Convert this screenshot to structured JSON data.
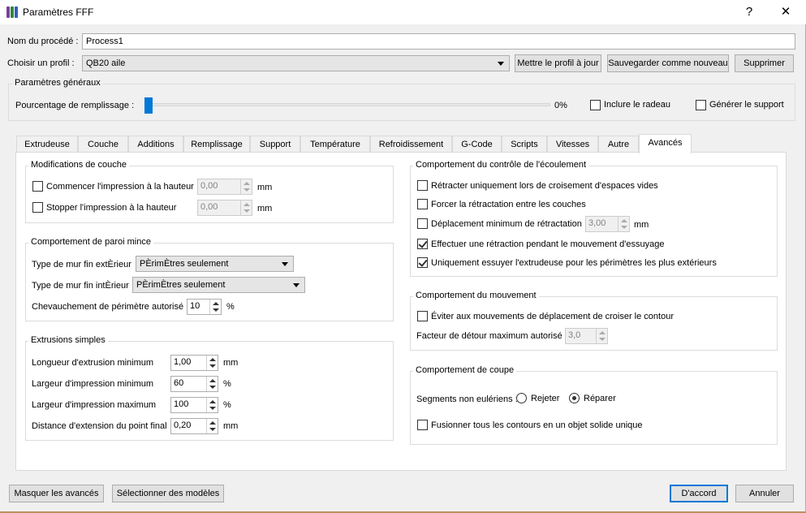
{
  "window": {
    "title": "Paramètres FFF",
    "help_glyph": "?",
    "close_glyph": "✕",
    "icon_colors": [
      "#7b3fa0",
      "#2e8b3a",
      "#2f5fb8"
    ]
  },
  "header": {
    "process_name_label": "Nom du procédé :",
    "process_name_value": "Process1",
    "profile_label": "Choisir un profil :",
    "profile_value": "QB20 aile",
    "update_profile_label": "Mettre le profil à jour",
    "save_as_new_label": "Sauvegarder comme nouveau",
    "delete_label": "Supprimer"
  },
  "general": {
    "title": "Paramètres généraux",
    "fill_percent_label": "Pourcentage de remplissage :",
    "fill_percent_value": "0%",
    "fill_percent_level": 0,
    "include_raft_label": "Inclure le radeau",
    "include_raft_checked": false,
    "generate_support_label": "Générer le support",
    "generate_support_checked": false
  },
  "tabs": [
    "Extrudeuse",
    "Couche",
    "Additions",
    "Remplissage",
    "Support",
    "Température",
    "Refroidissement",
    "G-Code",
    "Scripts",
    "Vitesses",
    "Autre",
    "Avancés"
  ],
  "active_tab": "Avancés",
  "layer_mods": {
    "title": "Modifications de couche",
    "start_label": "Commencer l'impression à la hauteur",
    "start_value": "0,00",
    "start_unit": "mm",
    "stop_label": "Stopper  l'impression à la hauteur",
    "stop_value": "0,00",
    "stop_unit": "mm"
  },
  "thin_wall": {
    "title": "Comportement de paroi mince",
    "outer_label": "Type de mur fin extÈrieur",
    "outer_value": "PÈrimÈtres seulement",
    "inner_label": "Type de mur fin intÈrieur",
    "inner_value": "PÈrimÈtres seulement",
    "overlap_label": "Chevauchement de périmètre autorisé",
    "overlap_value": "10",
    "overlap_unit": "%"
  },
  "single_extrusion": {
    "title": "Extrusions simples",
    "min_length_label": "Longueur d'extrusion minimum",
    "min_length_value": "1,00",
    "min_length_unit": "mm",
    "min_width_label": "Largeur d'impression minimum",
    "min_width_value": "60",
    "min_width_unit": "%",
    "max_width_label": "Largeur d'impression maximum",
    "max_width_value": "100",
    "max_width_unit": "%",
    "endpoint_label": "Distance d'extension du point final",
    "endpoint_value": "0,20",
    "endpoint_unit": "mm"
  },
  "ooze": {
    "title": "Comportement du contrôle de l'écoulement",
    "retract_open_label": "Rétracter uniquement lors de croisement d'espaces vides",
    "retract_open_checked": false,
    "force_retract_label": "Forcer la rétractation entre les couches",
    "force_retract_checked": false,
    "min_travel_label": "Déplacement minimum de rétractation",
    "min_travel_checked": false,
    "min_travel_value": "3,00",
    "min_travel_unit": "mm",
    "wipe_retract_label": "Effectuer une rétraction pendant le mouvement d'essuyage",
    "wipe_retract_checked": true,
    "wipe_outer_label": "Uniquement essuyer l'extrudeuse pour les périmètres les plus extérieurs",
    "wipe_outer_checked": true
  },
  "movement": {
    "title": "Comportement du mouvement",
    "avoid_crossing_label": "Éviter aux mouvements de déplacement de croiser le contour",
    "avoid_crossing_checked": false,
    "detour_label": "Facteur de détour maximum autorisé",
    "detour_value": "3,0"
  },
  "slicing": {
    "title": "Comportement de coupe",
    "segments_label": "Segments non eulériens :",
    "reject_label": "Rejeter",
    "repair_label": "Réparer",
    "selected": "Réparer",
    "merge_label": "Fusionner tous les contours en un objet solide unique",
    "merge_checked": false
  },
  "footer": {
    "hide_advanced_label": "Masquer les avancés",
    "select_models_label": "Sélectionner des modèles",
    "ok_label": "D'accord",
    "cancel_label": "Annuler"
  }
}
